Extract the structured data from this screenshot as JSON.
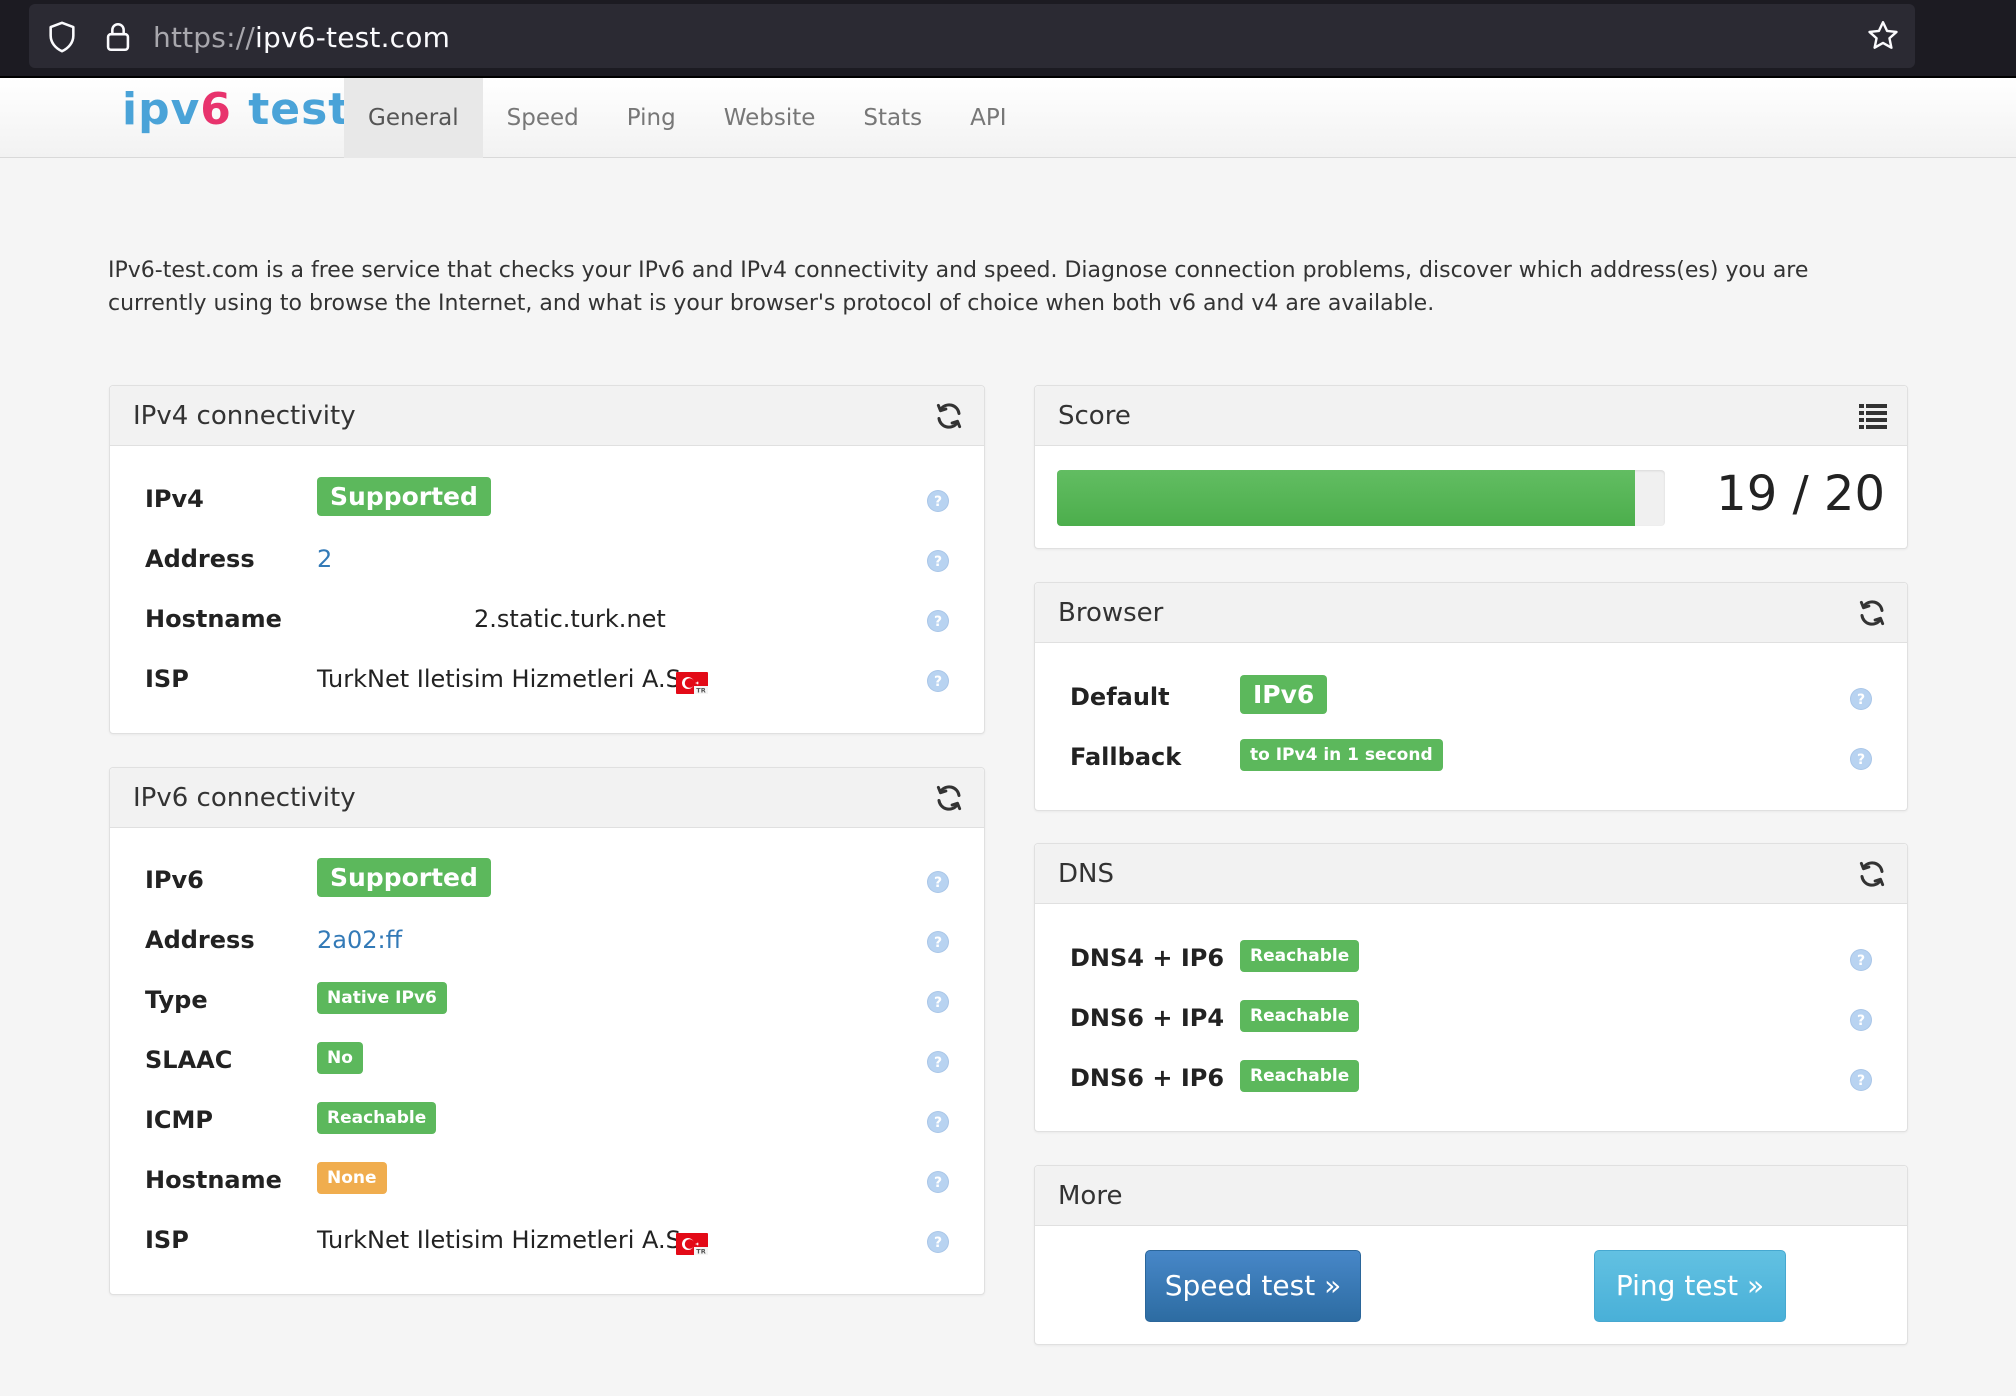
{
  "browser": {
    "url_scheme": "https://",
    "url_host": "ipv6-test.com"
  },
  "site": {
    "logo_a": "ipv",
    "logo_six": "6",
    "logo_b": " test",
    "tabs": [
      {
        "label": "General",
        "active": true
      },
      {
        "label": "Speed"
      },
      {
        "label": "Ping"
      },
      {
        "label": "Website"
      },
      {
        "label": "Stats"
      },
      {
        "label": "API"
      }
    ]
  },
  "intro": "IPv6-test.com is a free service that checks your IPv6 and IPv4 connectivity and speed. Diagnose connection problems, discover which address(es) you are currently using to browse the Internet, and what is your browser's protocol of choice when both v6 and v4 are available.",
  "ipv4": {
    "title": "IPv4 connectivity",
    "rows": {
      "ipv4_label": "IPv4",
      "ipv4_value": "Supported",
      "address_label": "Address",
      "address_value": "2",
      "hostname_label": "Hostname",
      "hostname_value": "2.static.turk.net",
      "isp_label": "ISP",
      "isp_value": "TurkNet Iletisim Hizmetleri A.S."
    }
  },
  "ipv6": {
    "title": "IPv6 connectivity",
    "rows": {
      "ipv6_label": "IPv6",
      "ipv6_value": "Supported",
      "address_label": "Address",
      "address_value": "2a02:ff",
      "type_label": "Type",
      "type_value": "Native IPv6",
      "slaac_label": "SLAAC",
      "slaac_value": "No",
      "icmp_label": "ICMP",
      "icmp_value": "Reachable",
      "hostname_label": "Hostname",
      "hostname_value": "None",
      "isp_label": "ISP",
      "isp_value": "TurkNet Iletisim Hizmetleri A.S."
    }
  },
  "score": {
    "title": "Score",
    "value": 19,
    "max": 20,
    "text": "19 / 20",
    "fill_fraction": 0.95
  },
  "browser_panel": {
    "title": "Browser",
    "default_label": "Default",
    "default_value": "IPv6",
    "fallback_label": "Fallback",
    "fallback_value": "to IPv4 in 1 second"
  },
  "dns": {
    "title": "DNS",
    "rows": [
      {
        "label": "DNS4 + IP6",
        "value": "Reachable"
      },
      {
        "label": "DNS6 + IP4",
        "value": "Reachable"
      },
      {
        "label": "DNS6 + IP6",
        "value": "Reachable"
      }
    ]
  },
  "more": {
    "title": "More",
    "speed_button": "Speed test »",
    "ping_button": "Ping test »"
  },
  "colors": {
    "success": "#5cb85c",
    "warning": "#f0ad4e",
    "link": "#337ab7",
    "primary": "#337ab7",
    "info": "#5bc0de",
    "logo_blue": "#4aa3d8",
    "logo_pink": "#e8336d"
  }
}
